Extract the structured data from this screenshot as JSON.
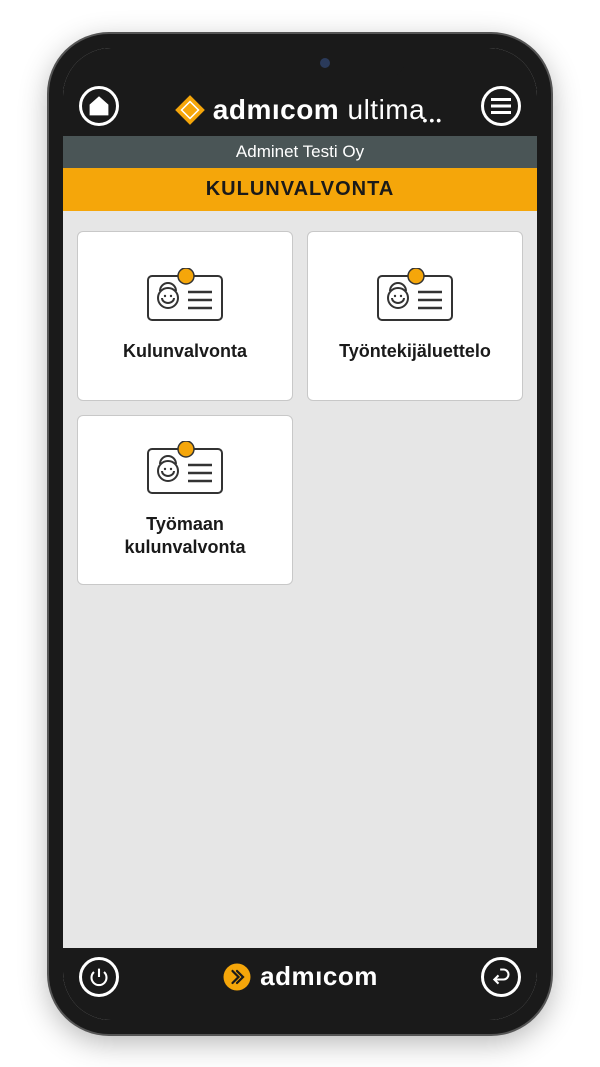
{
  "header": {
    "brand_bold": "admıcom",
    "brand_light": "ultima"
  },
  "subheader": {
    "company": "Adminet Testi Oy"
  },
  "section": {
    "title": "KULUNVALVONTA"
  },
  "cards": [
    {
      "label": "Kulunvalvonta"
    },
    {
      "label": "Työntekijäluettelo"
    },
    {
      "label": "Työmaan kulunvalvonta"
    }
  ],
  "footer": {
    "brand": "admıcom"
  }
}
